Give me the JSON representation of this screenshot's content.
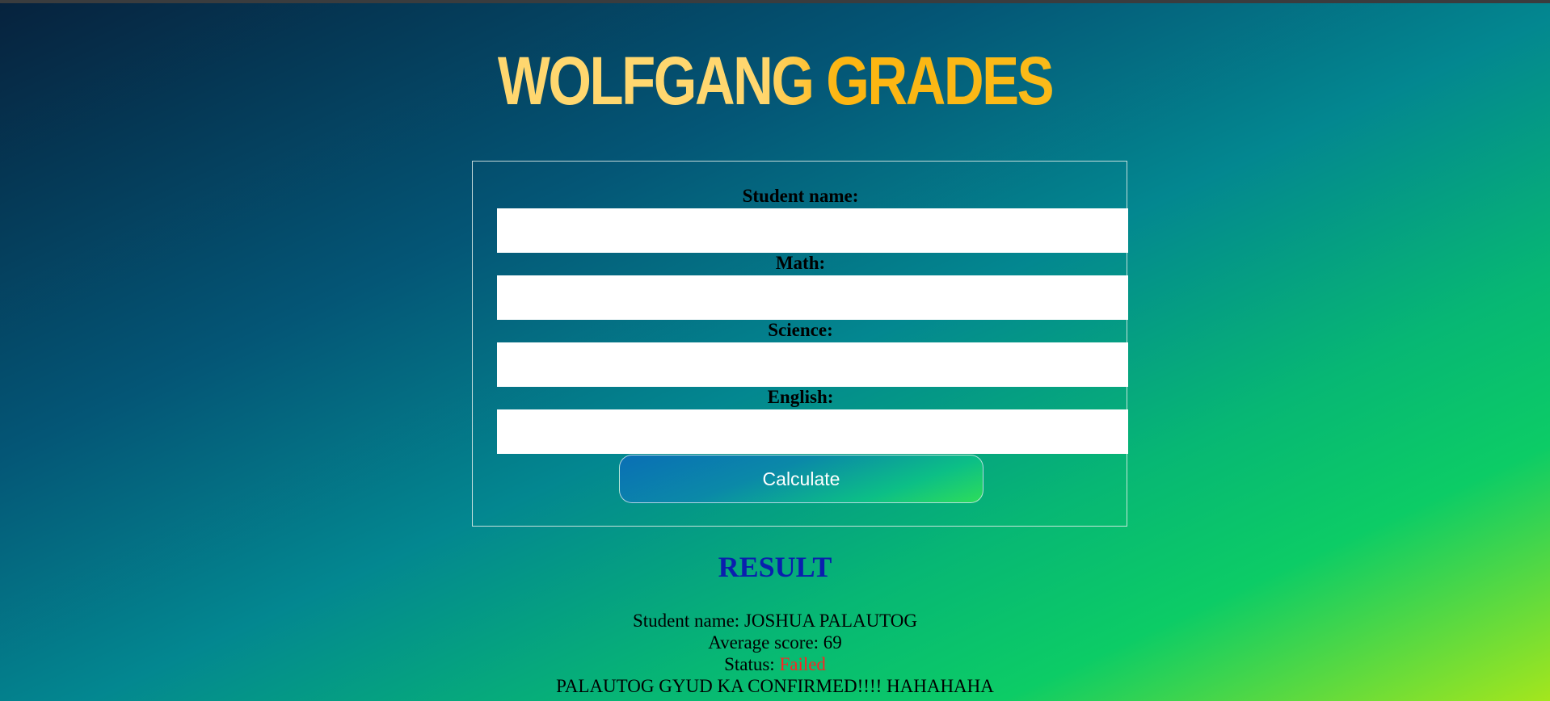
{
  "app": {
    "title": "WOLFGANG GRADES"
  },
  "form": {
    "fields": [
      {
        "label": "Student name:",
        "value": ""
      },
      {
        "label": "Math:",
        "value": ""
      },
      {
        "label": "Science:",
        "value": ""
      },
      {
        "label": "English:",
        "value": ""
      }
    ],
    "calculate_label": "Calculate"
  },
  "result": {
    "heading": "RESULT",
    "student_name_label": "Student name: ",
    "student_name": "JOSHUA PALAUTOG",
    "average_label": "Average score: ",
    "average": "69",
    "status_label": "Status: ",
    "status": "Failed",
    "message": "PALAUTOG GYUD KA CONFIRMED!!!! HAHAHAHA"
  },
  "colors": {
    "title_gold": "#fcb511",
    "title_light": "#ffd76f",
    "result_heading": "#0a1fae",
    "status_failed": "#ff2222"
  }
}
